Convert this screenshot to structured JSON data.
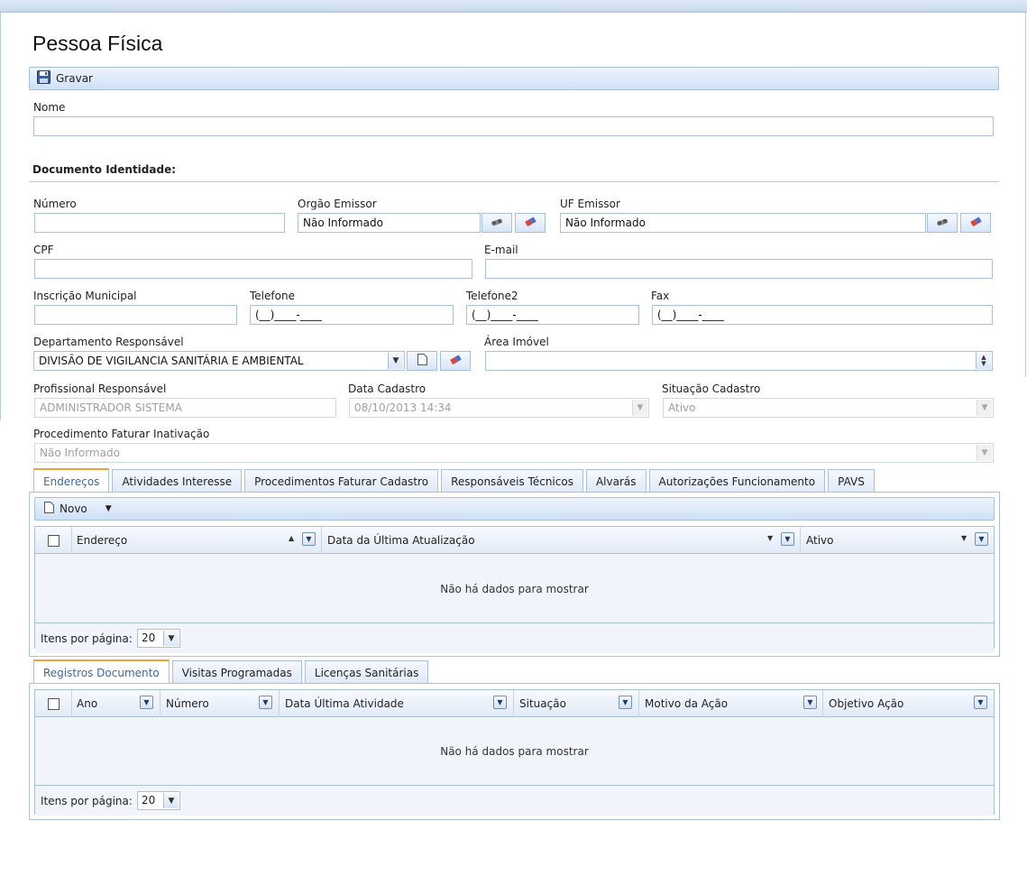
{
  "page": {
    "title": "Pessoa Física"
  },
  "toolbar": {
    "save_label": "Gravar"
  },
  "fields": {
    "nome": {
      "label": "Nome",
      "value": ""
    },
    "doc_section": "Documento Identidade:",
    "numero": {
      "label": "Número",
      "value": ""
    },
    "orgao_emissor": {
      "label": "Orgão Emissor",
      "value": "Não Informado"
    },
    "uf_emissor": {
      "label": "UF Emissor",
      "value": "Não Informado"
    },
    "cpf": {
      "label": "CPF",
      "value": ""
    },
    "email": {
      "label": "E-mail",
      "value": ""
    },
    "inscricao_municipal": {
      "label": "Inscrição Municipal",
      "value": ""
    },
    "telefone": {
      "label": "Telefone",
      "value": "(__)____-____"
    },
    "telefone2": {
      "label": "Telefone2",
      "value": "(__)____-____"
    },
    "fax": {
      "label": "Fax",
      "value": "(__)____-____"
    },
    "departamento": {
      "label": "Departamento Responsável",
      "value": "DIVISÃO DE VIGILANCIA SANITÁRIA E AMBIENTAL"
    },
    "area_imovel": {
      "label": "Área Imóvel",
      "value": ""
    },
    "profissional": {
      "label": "Profissional Responsável",
      "value": "ADMINISTRADOR SISTEMA"
    },
    "data_cadastro": {
      "label": "Data Cadastro",
      "value": "08/10/2013 14:34"
    },
    "situacao": {
      "label": "Situação Cadastro",
      "value": "Ativo"
    },
    "procedimento": {
      "label": "Procedimento Faturar Inativação",
      "value": "Não Informado"
    }
  },
  "tabs1": [
    "Endereços",
    "Atividades Interesse",
    "Procedimentos Faturar Cadastro",
    "Responsáveis Técnicos",
    "Alvarás",
    "Autorizações Funcionamento",
    "PAVS"
  ],
  "grid1": {
    "new_label": "Novo",
    "columns": [
      "Endereço",
      "Data da Última Atualização",
      "Ativo"
    ],
    "empty_text": "Não há dados para mostrar",
    "pager_label": "Itens por página:",
    "page_size": "20"
  },
  "tabs2": [
    "Registros Documento",
    "Visitas Programadas",
    "Licenças Sanitárias"
  ],
  "grid2": {
    "columns": [
      "Ano",
      "Número",
      "Data Última Atividade",
      "Situação",
      "Motivo da Ação",
      "Objetivo Ação"
    ],
    "empty_text": "Não há dados para mostrar",
    "pager_label": "Itens por página:",
    "page_size": "20"
  }
}
